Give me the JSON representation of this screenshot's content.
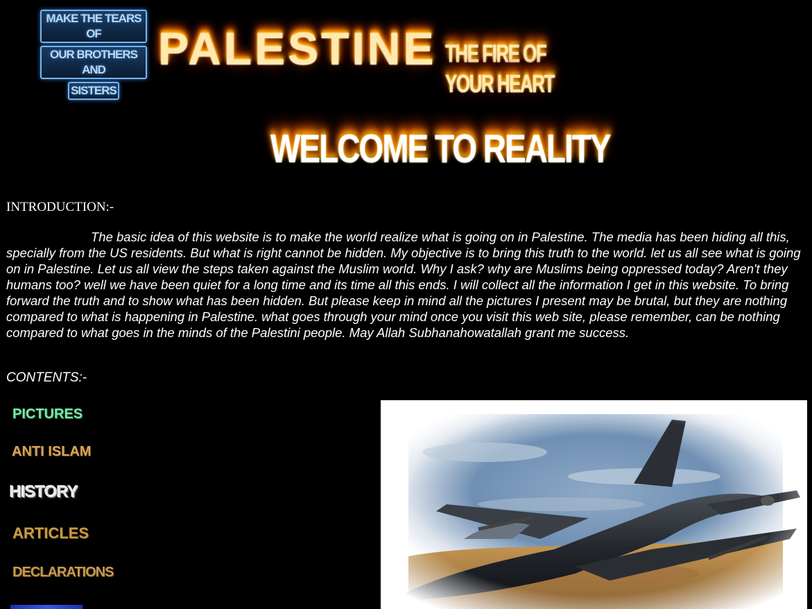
{
  "header": {
    "tagline_lines": [
      "MAKE THE TEARS OF",
      "OUR BROTHERS AND",
      "SISTERS"
    ],
    "title": "PALESTINE",
    "subtitle": "THE FIRE OF YOUR HEART",
    "welcome": "WELCOME TO REALITY"
  },
  "intro": {
    "heading": "INTRODUCTION:-",
    "body": "The basic idea of this website is to make the world realize what is going on in Palestine. The media has been hiding all this, specially from the US residents. But what is right cannot be hidden. My objective is to bring this truth to the world. let us all see what is going on in Palestine. Let us all view the  steps taken against the Muslim world. Why I ask? why are Muslims being oppressed today? Aren't they humans too? well we have been quiet for a long time and its time all this ends. I will collect all the information I get in this website. To bring forward the truth and to show what has been hidden. But please keep in mind all the pictures I present may be brutal, but they are nothing compared to what is happening in Palestine. what goes through your mind once you visit this web site, please remember, can be nothing compared to what goes in the minds of the Palestini people. May Allah Subhanahowatallah grant me success."
  },
  "contents": {
    "heading": "CONTENTS:-",
    "nav": {
      "pictures": "PICTURES",
      "anti_islam": "ANTI ISLAM",
      "history": "HISTORY",
      "articles": "ARTICLES",
      "declarations": "DECLARATIONS"
    }
  },
  "colors": {
    "background": "#000000",
    "text": "#ffffff",
    "fire": "#ff7a00"
  }
}
